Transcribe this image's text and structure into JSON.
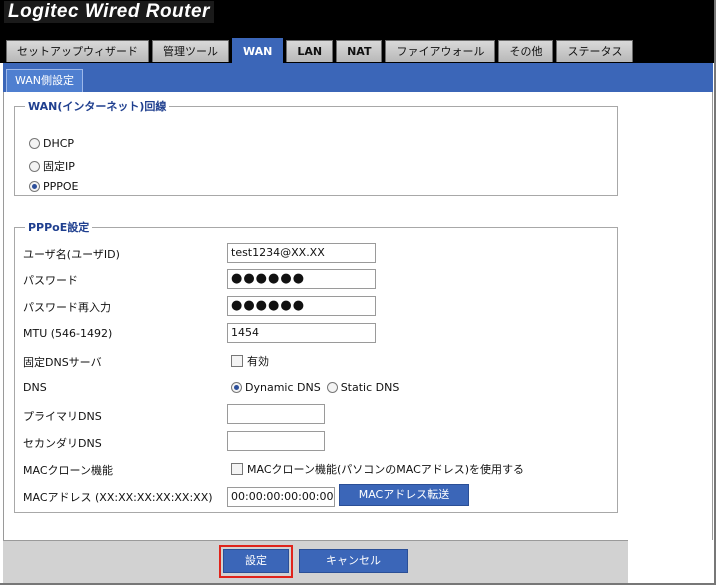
{
  "app": {
    "title": "Logitec  Wired  Router"
  },
  "tabs": [
    {
      "label": "セットアップウィザード",
      "active": false
    },
    {
      "label": "管理ツール",
      "active": false
    },
    {
      "label": "WAN",
      "active": true
    },
    {
      "label": "LAN",
      "active": false
    },
    {
      "label": "NAT",
      "active": false
    },
    {
      "label": "ファイアウォール",
      "active": false
    },
    {
      "label": "その他",
      "active": false
    },
    {
      "label": "ステータス",
      "active": false
    }
  ],
  "subtabs": [
    {
      "label": "WAN側設定"
    }
  ],
  "wan_line": {
    "legend": "WAN(インターネット)回線",
    "options": [
      {
        "label": "DHCP",
        "selected": false
      },
      {
        "label": "固定IP",
        "selected": false
      },
      {
        "label": "PPPOE",
        "selected": true
      }
    ]
  },
  "pppoe": {
    "legend": "PPPoE設定",
    "username": {
      "label": "ユーザ名(ユーザID)",
      "value": "test1234@XX.XX"
    },
    "password": {
      "label": "パスワード",
      "value": "●●●●●●"
    },
    "password_confirm": {
      "label": "パスワード再入力",
      "value": "●●●●●●"
    },
    "mtu": {
      "label": "MTU (546-1492)",
      "value": "1454"
    },
    "fixed_dns": {
      "label": "固定DNSサーバ",
      "checkbox_label": "有効",
      "checked": false
    },
    "dns": {
      "label": "DNS",
      "options": [
        {
          "label": "Dynamic DNS",
          "selected": true
        },
        {
          "label": "Static DNS",
          "selected": false
        }
      ]
    },
    "primary_dns": {
      "label": "プライマリDNS",
      "value": ""
    },
    "secondary_dns": {
      "label": "セカンダリDNS",
      "value": ""
    },
    "mac_clone": {
      "label": "MACクローン機能",
      "checkbox_label": "MACクローン機能(パソコンのMACアドレス)を使用する",
      "checked": false
    },
    "mac_address": {
      "label": "MACアドレス (XX:XX:XX:XX:XX:XX)",
      "value": "00:00:00:00:00:00",
      "button_label": "MACアドレス転送"
    }
  },
  "footer": {
    "save_label": "設定",
    "cancel_label": "キャンセル"
  },
  "colors": {
    "accent": "#3b66b8",
    "header_bg": "#000000",
    "focus_outline": "#e0241b",
    "legend_text": "#1f3f8f"
  }
}
